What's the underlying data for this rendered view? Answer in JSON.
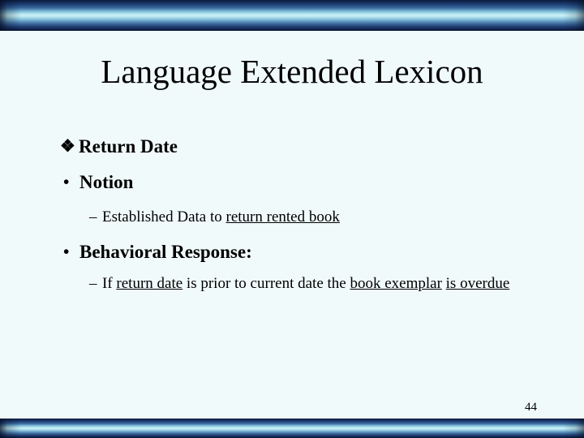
{
  "slide": {
    "title": "Language Extended Lexicon",
    "page_number": "44",
    "background_color": "#f1fafb",
    "band_dark_color": "#0b1a3d",
    "band_light_color": "#c9f0f5",
    "text_color": "#000000"
  },
  "markers": {
    "diamond": "❖",
    "disc": "•",
    "dash": "–"
  },
  "content": {
    "entry_name": "Return Date",
    "notion_label": "Notion",
    "notion_item_plain": "Established Data to ",
    "notion_item_underlined": "return rented book",
    "behavioral_label": "Behavioral Response:",
    "behavioral_item_part1": "If ",
    "behavioral_item_underlined1": "return date",
    "behavioral_item_part2": " is prior to current date the ",
    "behavioral_item_underlined2": "book exemplar",
    "behavioral_item_underlined3": "is overdue"
  }
}
